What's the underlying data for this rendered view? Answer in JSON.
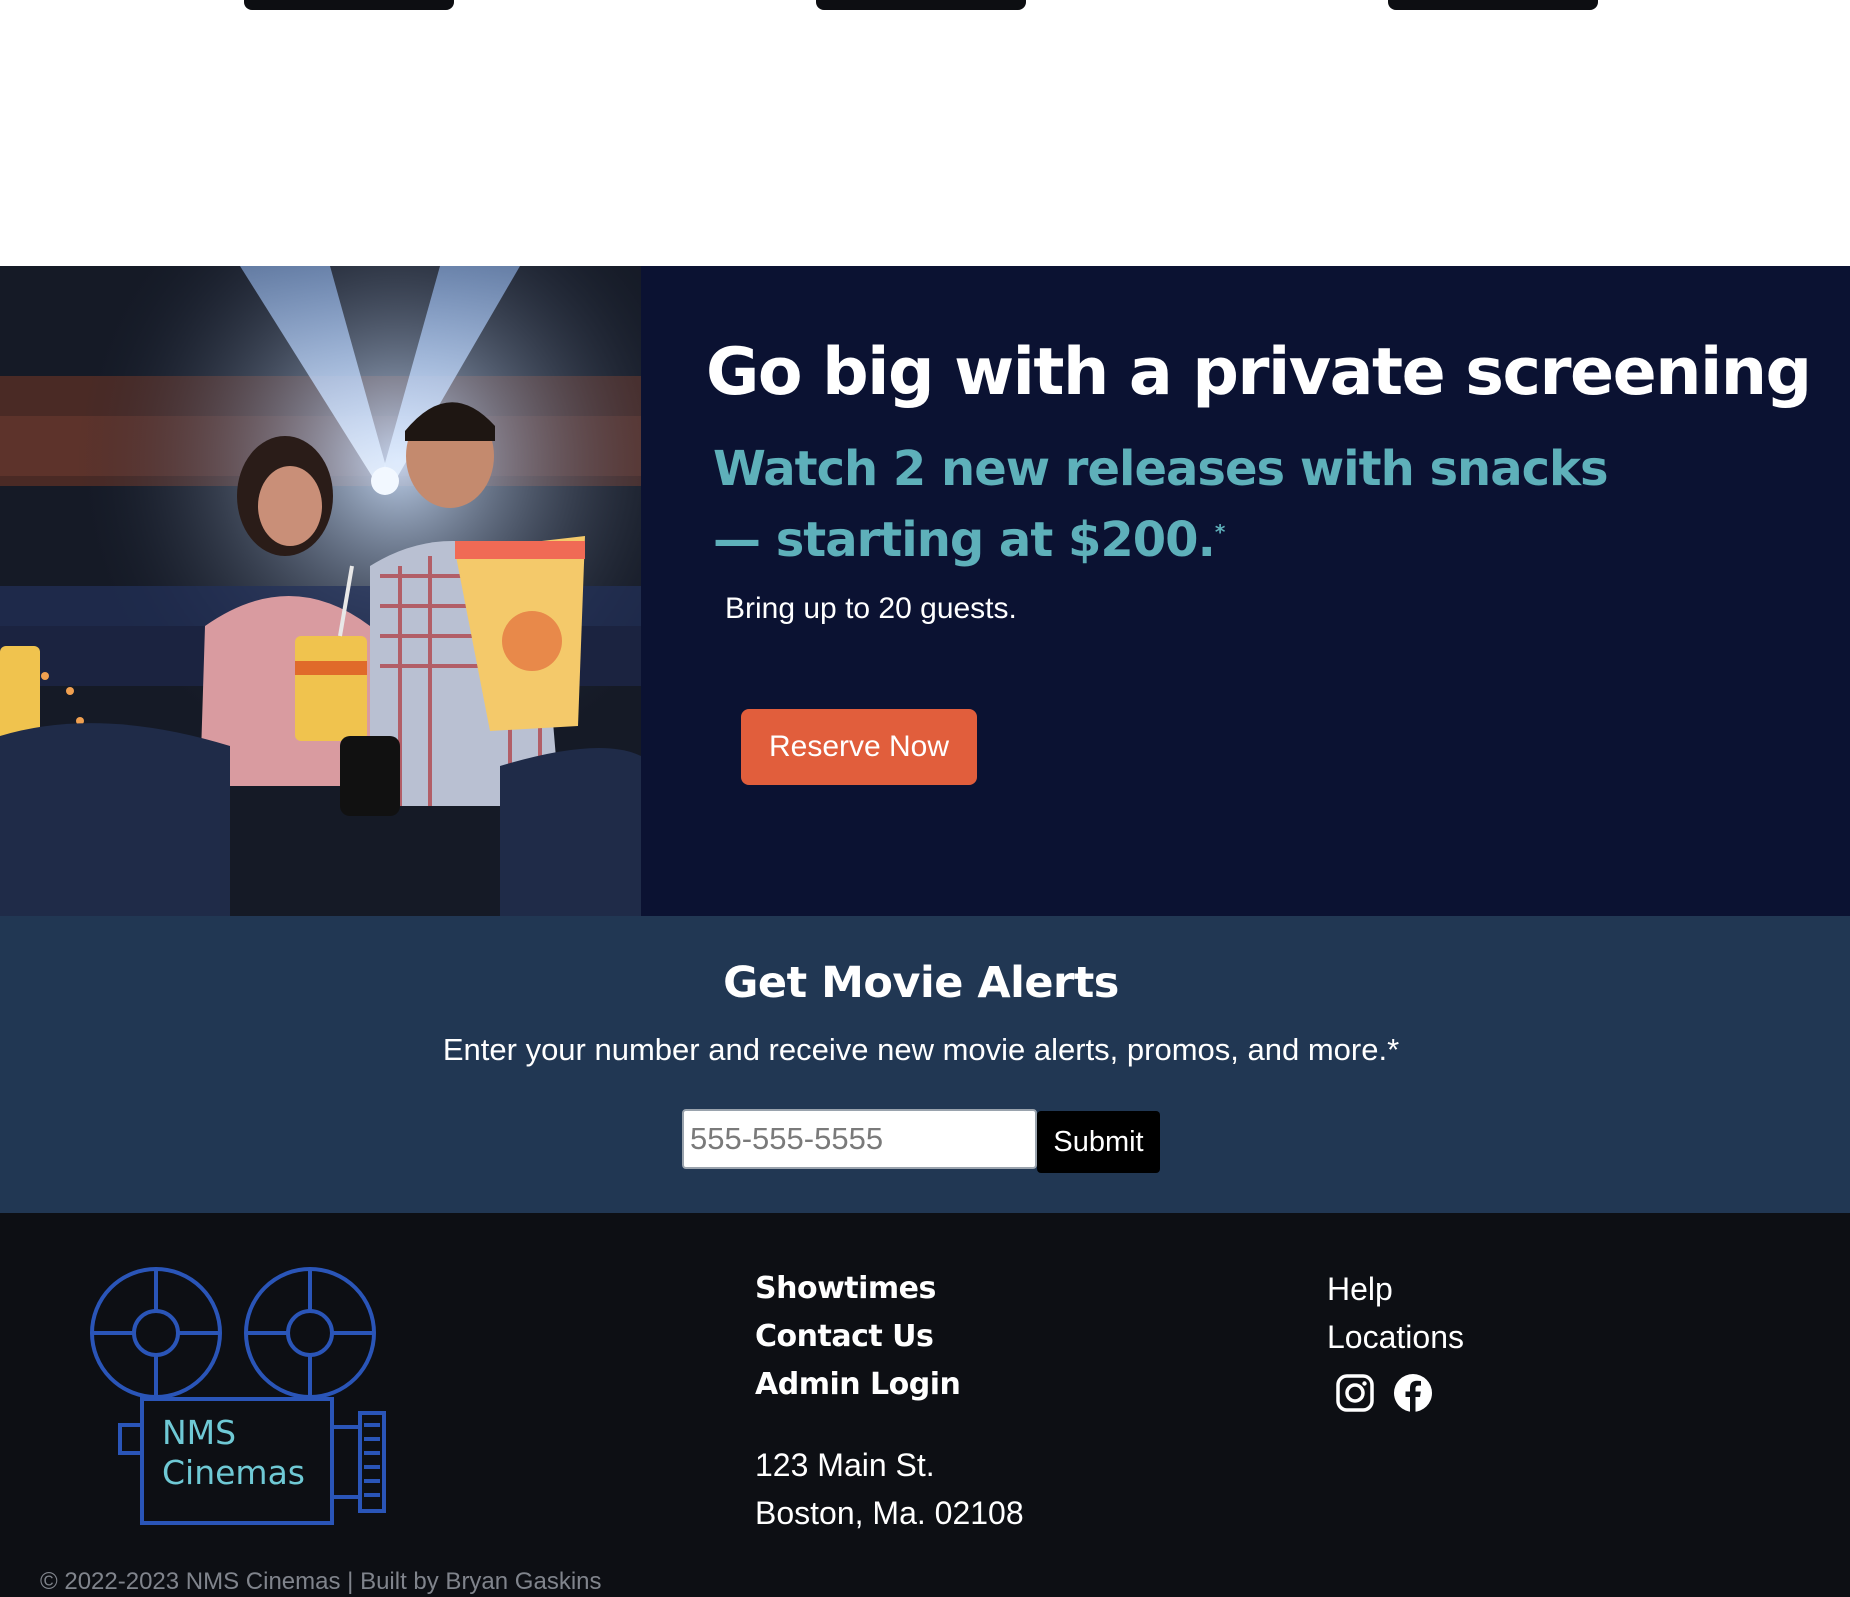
{
  "screening": {
    "title": "Go big with a private screening",
    "subtitle": "Watch 2 new releases with snacks — starting at $200.",
    "subtitle_mark": "*",
    "guests": "Bring up to 20 guests.",
    "cta": "Reserve Now"
  },
  "alerts": {
    "title": "Get Movie Alerts",
    "text": "Enter your number and receive new movie alerts, promos, and more.*",
    "phone_placeholder": "555-555-5555",
    "submit": "Submit"
  },
  "footer": {
    "logo_text": "NMS\nCinemas",
    "links": [
      "Showtimes",
      "Contact Us",
      "Admin Login"
    ],
    "address_line1": "123 Main St.",
    "address_line2": "Boston, Ma. 02108",
    "secondary_links": [
      "Help",
      "Locations"
    ],
    "social": [
      "instagram-icon",
      "facebook-icon"
    ],
    "copyright": "© 2022-2023 NMS Cinemas | Built by Bryan Gaskins"
  },
  "colors": {
    "screening_bg": "#0b1232",
    "accent_teal": "#5eb0ba",
    "cta_orange": "#e15e3c",
    "alerts_bg": "#213753",
    "footer_bg": "#0d0f14",
    "logo_blue": "#2a55b8"
  }
}
